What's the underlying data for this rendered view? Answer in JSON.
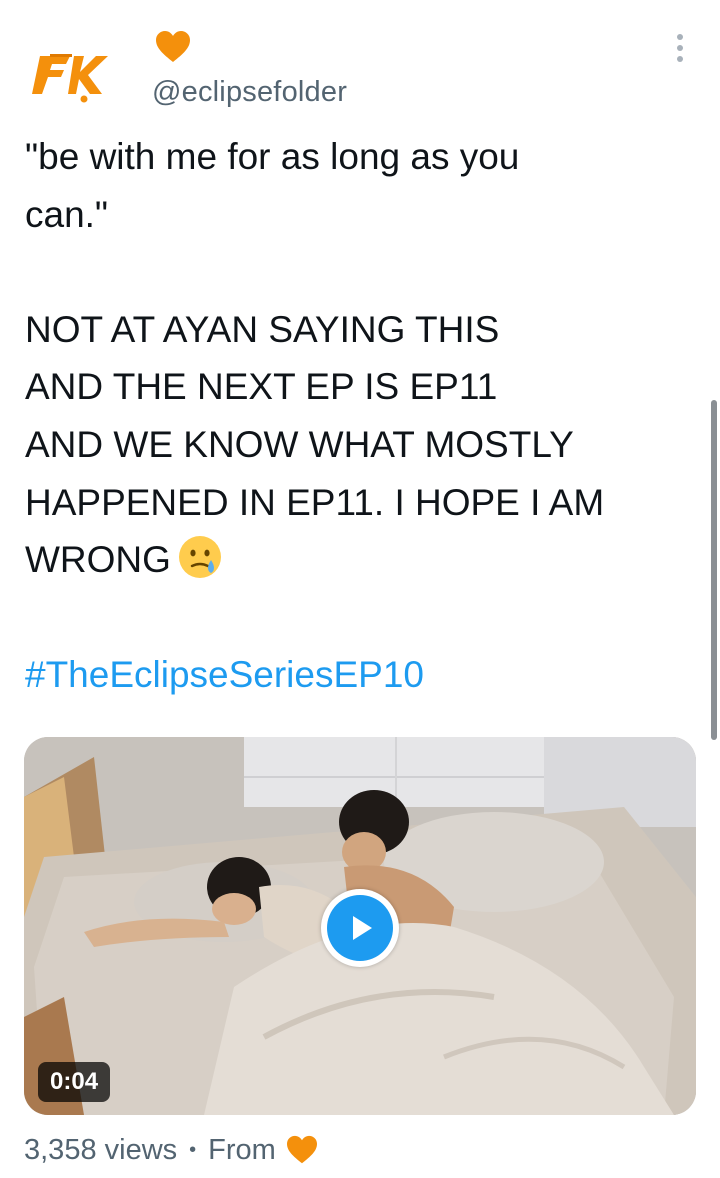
{
  "author": {
    "logo_text": "FK",
    "display_name_icon": "orange-heart-icon",
    "handle": "@eclipsefolder"
  },
  "tweet": {
    "line1": "\"be with me for as long as you",
    "line2": "can.\"",
    "line3": "NOT AT AYAN SAYING THIS",
    "line4": "AND THE NEXT EP IS EP11",
    "line5": "AND WE KNOW WHAT MOSTLY",
    "line6": "HAPPENED IN EP11. I HOPE I AM",
    "line7": "WRONG",
    "emoji": "crying-face-emoji",
    "hashtag": "#TheEclipseSeriesEP10"
  },
  "media": {
    "duration": "0:04",
    "play_icon": "play-icon"
  },
  "meta": {
    "views": "3,358 views",
    "separator": "•",
    "from_label": "From",
    "from_icon": "orange-heart-icon"
  },
  "colors": {
    "accent": "#1d9bf0",
    "heart": "#f4900c",
    "secondary_text": "#536471"
  }
}
